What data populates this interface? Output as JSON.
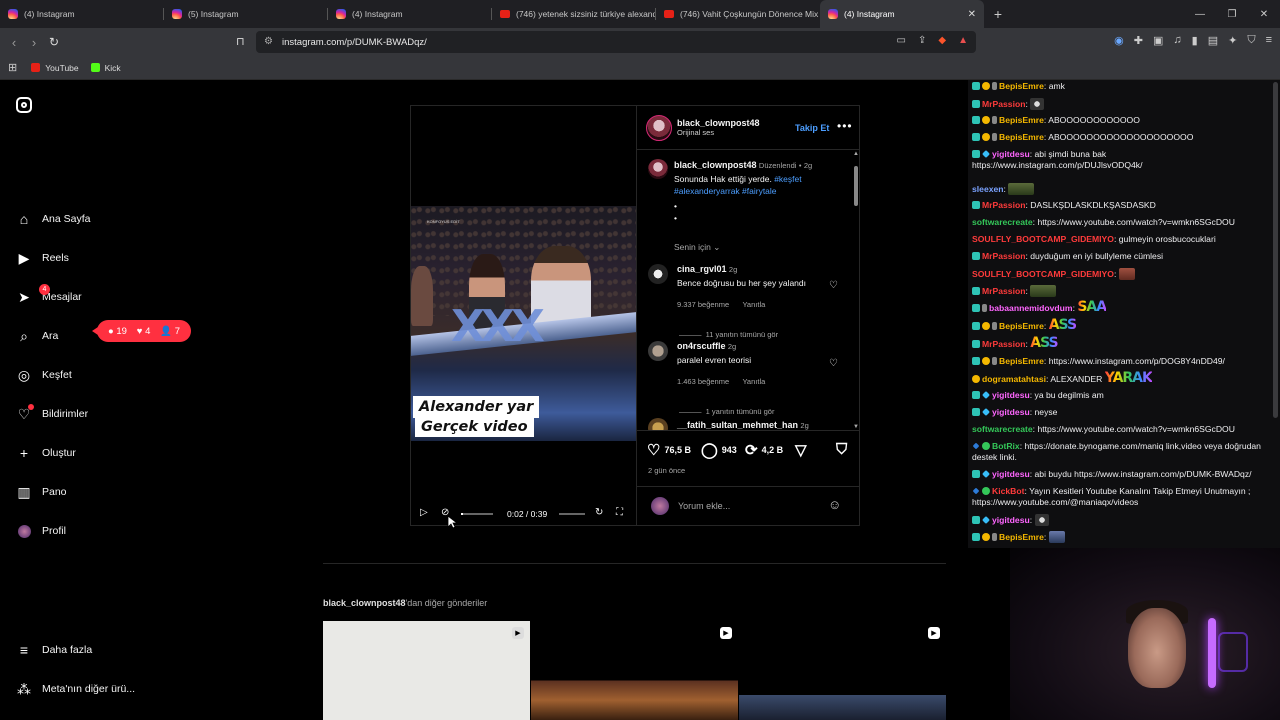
{
  "browser": {
    "tabs": [
      {
        "title": "(4) Instagram",
        "icon": "instagram-icon",
        "active": false
      },
      {
        "title": "(5) Instagram",
        "icon": "instagram-icon",
        "active": false
      },
      {
        "title": "(4) Instagram",
        "icon": "instagram-icon",
        "active": false
      },
      {
        "title": "(746) yetenek sizsiniz türkiye alexand",
        "icon": "youtube-icon",
        "active": false
      },
      {
        "title": "(746) Vahit Çoşkungün Dönence Mix",
        "icon": "youtube-icon",
        "active": false
      },
      {
        "title": "(4) Instagram",
        "icon": "instagram-icon",
        "active": true
      }
    ],
    "url": "instagram.com/p/DUMK-BWADqz/",
    "bookmarks": [
      {
        "label": "YouTube",
        "color": "#e62117"
      },
      {
        "label": "Kick",
        "color": "#53fc18"
      }
    ]
  },
  "sidebar": {
    "items": [
      {
        "label": "Ana Sayfa",
        "icon": "home-icon"
      },
      {
        "label": "Reels",
        "icon": "reels-icon"
      },
      {
        "label": "Mesajlar",
        "icon": "messages-icon",
        "badge": "4"
      },
      {
        "label": "Ara",
        "icon": "search-icon"
      },
      {
        "label": "Keşfet",
        "icon": "explore-icon"
      },
      {
        "label": "Bildirimler",
        "icon": "heart-icon"
      },
      {
        "label": "Oluştur",
        "icon": "plus-icon"
      },
      {
        "label": "Pano",
        "icon": "dashboard-icon"
      },
      {
        "label": "Profil",
        "icon": "avatar"
      }
    ],
    "more_label": "Daha fazla",
    "meta_label": "Meta'nın diğer ürü...",
    "notif_pill": {
      "comments": "19",
      "likes": "4",
      "follows": "7"
    }
  },
  "post": {
    "video": {
      "caption_line1": "Alexander yar",
      "caption_line2": "Gerçek video",
      "small_tag": "KONFOYUS EDİT",
      "time": "0:02 / 0:39",
      "progress": 0.05
    },
    "header": {
      "username": "black_clownpost48",
      "audio": "Orijinal ses",
      "follow": "Takip Et"
    },
    "caption": {
      "username": "black_clownpost48",
      "edited": "Düzenlendi",
      "age": "2g",
      "text": "Sonunda Hak ettiği yerde.",
      "tags": "#keşfet #alexanderyarrak #fairytale",
      "dot1": "•",
      "dot2": "•"
    },
    "sort_label": "Senin için",
    "comments": [
      {
        "user": "cina_rgvl01",
        "age": "2g",
        "text": "Bence doğrusu bu her şey yalandı",
        "likes": "9.337 beğenme",
        "reply": "Yanıtla",
        "view_replies": "11 yanıtın tümünü gör"
      },
      {
        "user": "on4rscuffle",
        "age": "2g",
        "text": "paralel evren teorisi",
        "likes": "1.463 beğenme",
        "reply": "Yanıtla",
        "view_replies": "1 yanıtın tümünü gör"
      },
      {
        "user": "__fatih_sultan_mehmet_han",
        "age": "2g"
      }
    ],
    "actions": {
      "likes": "76,5 B",
      "comments": "943",
      "reposts": "4,2 B",
      "date": "2 gün önce"
    },
    "add_comment_placeholder": "Yorum ekle..."
  },
  "more_from": {
    "user": "black_clownpost48",
    "suffix": "'dan diğer gönderiler"
  },
  "chat": {
    "messages": [
      {
        "user": "BepisEmre",
        "color": "#f5b800",
        "badges": [
          "sub",
          "gold",
          "mic"
        ],
        "text": "amk"
      },
      {
        "user": "MrPassion",
        "color": "#ff3b3b",
        "badges": [
          "sub"
        ],
        "text": "",
        "emote": "small-emote"
      },
      {
        "user": "BepisEmre",
        "color": "#f5b800",
        "badges": [
          "sub",
          "gold",
          "mic"
        ],
        "text": "ABOOOOOOOOOOOO"
      },
      {
        "user": "BepisEmre",
        "color": "#f5b800",
        "badges": [
          "sub",
          "gold",
          "mic"
        ],
        "text": "ABOOOOOOOOOOOOOOOOOOOO"
      },
      {
        "user": "yigitdesu",
        "color": "#ff66ff",
        "badges": [
          "sub",
          "diamond"
        ],
        "text": "abi şimdi buna bak https://www.instagram.com/p/DUJlsvODQ4k/"
      },
      {
        "user": "sleexen",
        "color": "#7aa2ff",
        "badges": [],
        "text": "",
        "emote": "tank-emote"
      },
      {
        "user": "MrPassion",
        "color": "#ff3b3b",
        "badges": [
          "sub"
        ],
        "text": "DASLKŞDLASKDLKŞASDASKD"
      },
      {
        "user": "softwarecreate",
        "color": "#34c759",
        "badges": [],
        "text": "https://www.youtube.com/watch?v=wmkn6SGcDOU"
      },
      {
        "user": "SOULFLY_BOOTCAMP_GIDEMIYO",
        "color": "#ff3b3b",
        "badges": [],
        "text": "gulmeyin orosbucocuklari"
      },
      {
        "user": "MrPassion",
        "color": "#ff3b3b",
        "badges": [
          "sub"
        ],
        "text": "duyduğum en iyi bullyleme cümlesi"
      },
      {
        "user": "SOULFLY_BOOTCAMP_GIDEMIYO",
        "color": "#ff3b3b",
        "badges": [],
        "text": "",
        "emote": "face-emote"
      },
      {
        "user": "MrPassion",
        "color": "#ff3b3b",
        "badges": [
          "sub"
        ],
        "text": "",
        "emote": "tank-emote"
      },
      {
        "user": "babaannemidovdum",
        "color": "#ff66ff",
        "badges": [
          "sub",
          "mic"
        ],
        "text": "",
        "emote_text": "SAA"
      },
      {
        "user": "BepisEmre",
        "color": "#f5b800",
        "badges": [
          "sub",
          "gold",
          "mic"
        ],
        "text": "",
        "emote_text": "ASS"
      },
      {
        "user": "MrPassion",
        "color": "#ff3b3b",
        "badges": [
          "sub"
        ],
        "text": "",
        "emote_text": "ASS"
      },
      {
        "user": "BepisEmre",
        "color": "#f5b800",
        "badges": [
          "sub",
          "gold",
          "mic"
        ],
        "text": "https://www.instagram.com/p/DOG8Y4nDD49/"
      },
      {
        "user": "dogramatahtasi",
        "color": "#f5b800",
        "badges": [
          "gold"
        ],
        "text": "ALEXANDER",
        "emote_text": "YARAK"
      },
      {
        "user": "yigitdesu",
        "color": "#ff66ff",
        "badges": [
          "sub",
          "diamond"
        ],
        "text": "ya bu degilmis am"
      },
      {
        "user": "yigitdesu",
        "color": "#ff66ff",
        "badges": [
          "sub",
          "diamond"
        ],
        "text": "neyse"
      },
      {
        "user": "softwarecreate",
        "color": "#34c759",
        "badges": [],
        "text": "https://www.youtube.com/watch?v=wmkn6SGcDOU"
      },
      {
        "user": "BotRix",
        "color": "#34c759",
        "badges": [
          "tool",
          "ver"
        ],
        "text": "https://donate.bynogame.com/maniq link,video veya doğrudan destek linki."
      },
      {
        "user": "yigitdesu",
        "color": "#ff66ff",
        "badges": [
          "sub",
          "diamond"
        ],
        "text": "abi buydu https://www.instagram.com/p/DUMK-BWADqz/"
      },
      {
        "user": "KickBot",
        "color": "#ff3b3b",
        "badges": [
          "tool",
          "ver"
        ],
        "text": "Yayın Kesitleri Youtube Kanalını Takip Etmeyi Unutmayın ; https://www.youtube.com/@maniaqx/videos"
      },
      {
        "user": "yigitdesu",
        "color": "#ff66ff",
        "badges": [
          "sub",
          "diamond"
        ],
        "text": "",
        "emote": "small-emote"
      },
      {
        "user": "BepisEmre",
        "color": "#f5b800",
        "badges": [
          "sub",
          "gold",
          "mic"
        ],
        "text": "",
        "emote": "car-emote"
      }
    ]
  }
}
